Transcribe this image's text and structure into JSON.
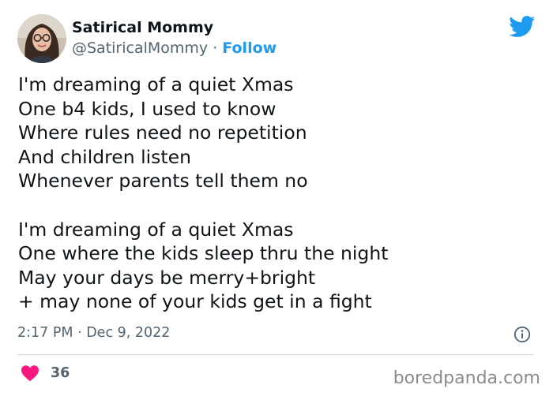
{
  "user": {
    "display_name": "Satirical Mommy",
    "handle": "@SatiricalMommy",
    "separator": " · ",
    "follow_label": "Follow"
  },
  "tweet": {
    "text": "I'm dreaming of a quiet Xmas\nOne b4 kids, I used to know\nWhere rules need no repetition\nAnd children listen\nWhenever parents tell them no\n\nI'm dreaming of a quiet Xmas\nOne where the kids sleep thru the night\nMay your days be merry+bright\n+ may none of your kids get in a fight",
    "timestamp": "2:17 PM · Dec 9, 2022",
    "likes": "36"
  },
  "watermark": "boredpanda.com",
  "icons": {
    "brand": "twitter-bird-icon",
    "info": "info-icon",
    "like": "heart-icon"
  },
  "colors": {
    "twitter_blue": "#1d9bf0",
    "like_pink": "#f91880",
    "secondary_text": "#536471"
  }
}
